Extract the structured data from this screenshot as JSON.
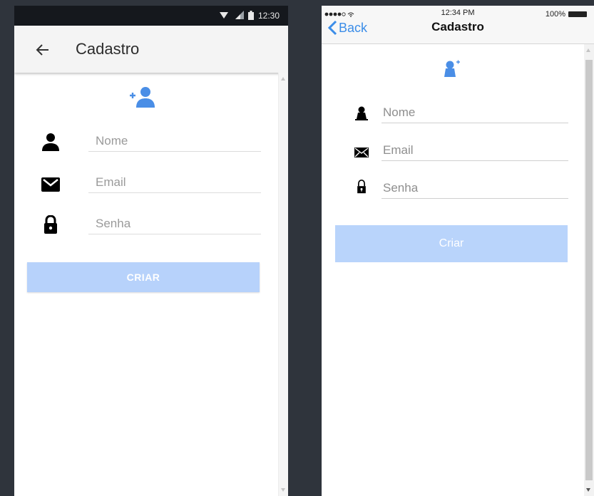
{
  "android": {
    "status_time": "12:30",
    "title": "Cadastro",
    "fields": {
      "name_placeholder": "Nome",
      "email_placeholder": "Email",
      "password_placeholder": "Senha"
    },
    "button_label": "CRIAR",
    "colors": {
      "accent": "#4a8ee6",
      "button": "#b7d2fb"
    }
  },
  "ios": {
    "status_time": "12:34 PM",
    "battery": "100%",
    "back_label": "Back",
    "title": "Cadastro",
    "fields": {
      "name_placeholder": "Nome",
      "email_placeholder": "Email",
      "password_placeholder": "Senha"
    },
    "button_label": "Criar",
    "colors": {
      "accent": "#3b8de8",
      "button": "#b9d4fb"
    }
  }
}
